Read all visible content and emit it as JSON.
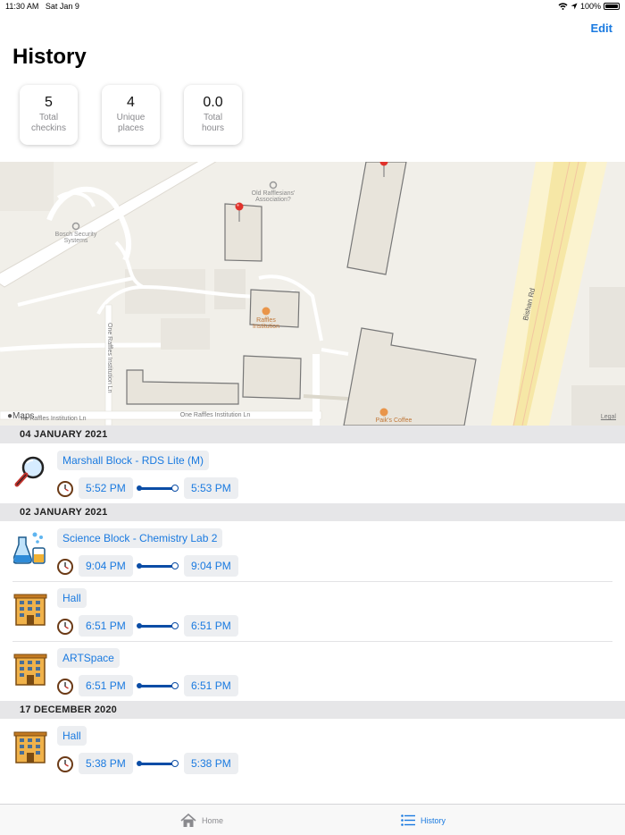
{
  "status_bar": {
    "time": "11:30 AM",
    "date": "Sat Jan 9",
    "battery": "100%"
  },
  "header": {
    "edit_label": "Edit",
    "title": "History"
  },
  "stats": [
    {
      "value": "5",
      "label": "Total\ncheckins"
    },
    {
      "value": "4",
      "label": "Unique\nplaces"
    },
    {
      "value": "0.0",
      "label": "Total\nhours"
    }
  ],
  "map": {
    "maps_label": "Maps",
    "legal_label": "Legal",
    "labels": {
      "old_rafflesians": "Old Rafflesians'",
      "old_rafflesians_2": "Association?",
      "bosch_1": "Bosch Security",
      "bosch_2": "Systems",
      "raffles_1": "Raffles",
      "raffles_2": "Institution",
      "one_raffles_ln": "One Raffles Institution Ln",
      "one_raffles_ln_v": "One Raffles Institution Ln",
      "one_raffles_ln_left": "ne Raffles Institution Ln",
      "bishan_rd": "Bishan Rd",
      "paiks_coffee": "Paik's Coffee"
    }
  },
  "sections": [
    {
      "date": "04 JANUARY 2021",
      "entries": [
        {
          "icon": "magnifier-icon",
          "place": "Marshall Block  -  RDS Lite (M)",
          "start": "5:52 PM",
          "end": "5:53 PM"
        }
      ]
    },
    {
      "date": "02 JANUARY 2021",
      "entries": [
        {
          "icon": "lab-flask-icon",
          "place": "Science Block  -  Chemistry Lab 2",
          "start": "9:04 PM",
          "end": "9:04 PM"
        },
        {
          "icon": "building-icon",
          "place": "Hall",
          "start": "6:51 PM",
          "end": "6:51 PM"
        },
        {
          "icon": "building-icon",
          "place": "ARTSpace",
          "start": "6:51 PM",
          "end": "6:51 PM"
        }
      ]
    },
    {
      "date": "17 DECEMBER 2020",
      "entries": [
        {
          "icon": "building-icon",
          "place": "Hall",
          "start": "5:38 PM",
          "end": "5:38 PM"
        }
      ]
    }
  ],
  "tabs": {
    "home": "Home",
    "history": "History"
  },
  "colors": {
    "accent": "#1a7ae0",
    "duration_bar": "#0b4da6",
    "section_bg": "#e6e6e8"
  }
}
